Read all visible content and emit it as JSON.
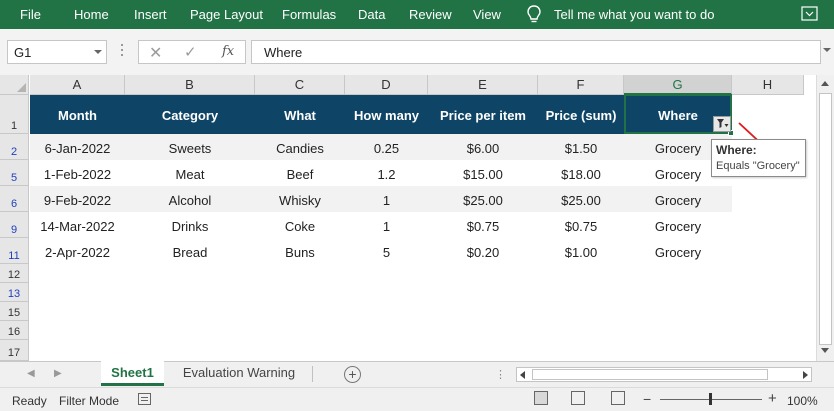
{
  "ribbon": {
    "tabs": [
      "File",
      "Home",
      "Insert",
      "Page Layout",
      "Formulas",
      "Data",
      "Review",
      "View"
    ],
    "tell_me": "Tell me what you want to do",
    "bg_color": "#217346"
  },
  "formula_bar": {
    "name_box": "G1",
    "cancel_icon": "✕",
    "enter_icon": "✓",
    "fx_label": "fx",
    "content": "Where"
  },
  "columns": [
    "A",
    "B",
    "C",
    "D",
    "E",
    "F",
    "G",
    "H"
  ],
  "active_column": "G",
  "row_numbers": [
    "1",
    "2",
    "5",
    "6",
    "9",
    "11",
    "12",
    "13",
    "15",
    "16",
    "17"
  ],
  "table": {
    "header_color": "#0e4566",
    "headers": [
      "Month",
      "Category",
      "What",
      "How many",
      "Price per item",
      "Price (sum)",
      "Where"
    ],
    "rows": [
      [
        "6-Jan-2022",
        "Sweets",
        "Candies",
        "0.25",
        "$6.00",
        "$1.50",
        "Grocery"
      ],
      [
        "1-Feb-2022",
        "Meat",
        "Beef",
        "1.2",
        "$15.00",
        "$18.00",
        "Grocery"
      ],
      [
        "9-Feb-2022",
        "Alcohol",
        "Whisky",
        "1",
        "$25.00",
        "$25.00",
        "Grocery"
      ],
      [
        "14-Mar-2022",
        "Drinks",
        "Coke",
        "1",
        "$0.75",
        "$0.75",
        "Grocery"
      ],
      [
        "2-Apr-2022",
        "Bread",
        "Buns",
        "5",
        "$0.20",
        "$1.00",
        "Grocery"
      ]
    ]
  },
  "filter_tooltip": {
    "title": "Where:",
    "body": "Equals \"Grocery\""
  },
  "sheet_tabs": {
    "active": "Sheet1",
    "other": "Evaluation Warning",
    "add_icon": "+"
  },
  "status_bar": {
    "ready": "Ready",
    "mode": "Filter Mode",
    "zoom_minus": "−",
    "zoom_plus": "+",
    "zoom": "100%"
  }
}
